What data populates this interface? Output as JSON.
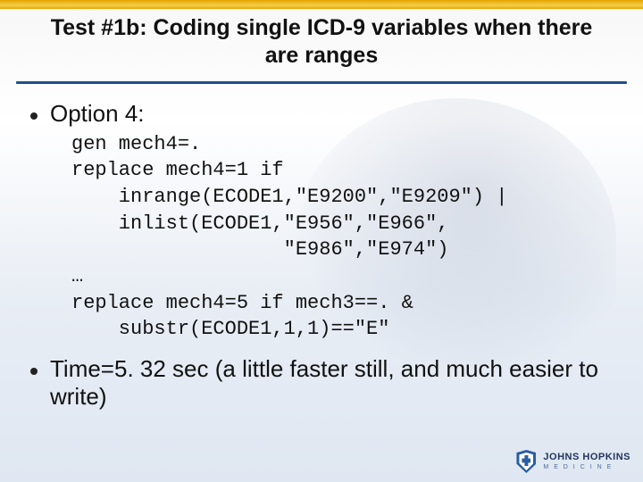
{
  "title": "Test #1b: Coding single ICD-9 variables when there are ranges",
  "bullets": {
    "option": "Option 4:",
    "timing": "Time=5. 32 sec (a little faster still, and much easier to write)"
  },
  "code": "gen mech4=.\nreplace mech4=1 if\n    inrange(ECODE1,\"E9200\",\"E9209\") |\n    inlist(ECODE1,\"E956\",\"E966\",\n                  \"E986\",\"E974\")\n…\nreplace mech4=5 if mech3==. &\n    substr(ECODE1,1,1)==\"E\"",
  "logo": {
    "name": "JOHNS HOPKINS",
    "sub": "M E D I C I N E"
  }
}
